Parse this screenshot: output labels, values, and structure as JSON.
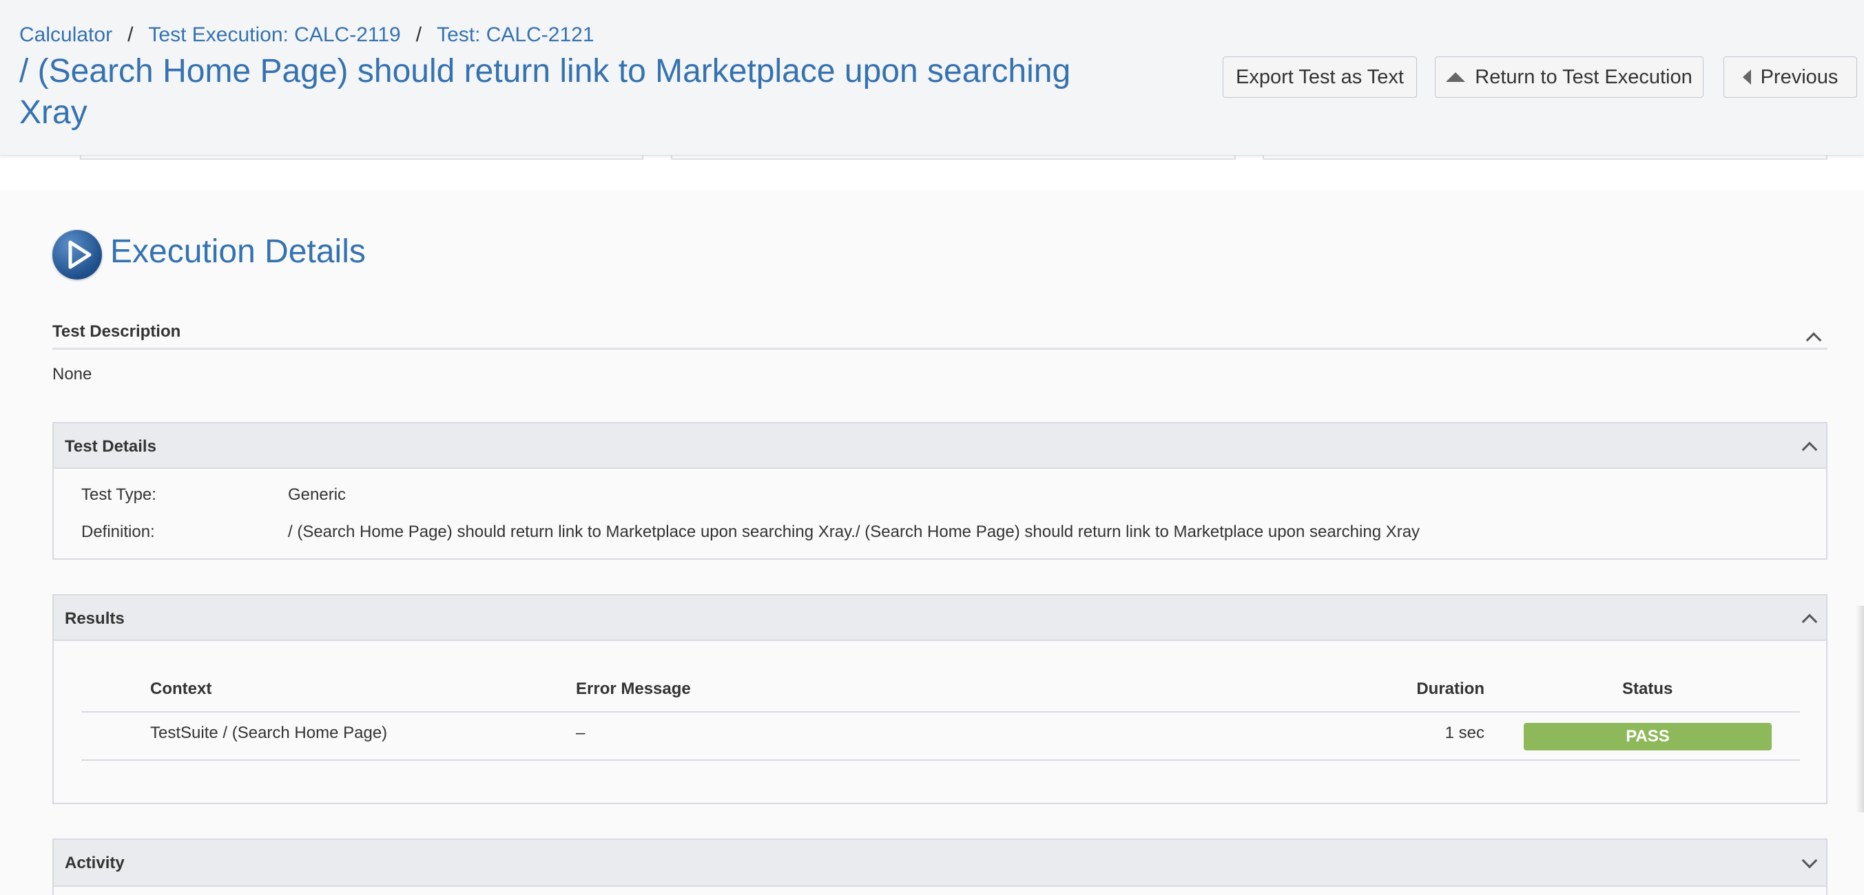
{
  "breadcrumb": {
    "items": [
      "Calculator",
      "Test Execution: CALC-2119",
      "Test: CALC-2121"
    ],
    "separator": "/"
  },
  "page_title": "/ (Search Home Page) should return link to Marketplace upon searching Xray",
  "header_buttons": {
    "export_label": "Export Test as Text",
    "return_label": "Return to Test Execution",
    "previous_label": "Previous"
  },
  "execution_details": {
    "title": "Execution Details",
    "icon": "play-icon"
  },
  "test_description": {
    "label": "Test Description",
    "value": "None"
  },
  "test_details": {
    "label": "Test Details",
    "test_type_label": "Test Type:",
    "test_type_value": "Generic",
    "definition_label": "Definition:",
    "definition_value": "/ (Search Home Page) should return link to Marketplace upon searching Xray./ (Search Home Page) should return link to Marketplace upon searching Xray"
  },
  "results": {
    "label": "Results",
    "columns": [
      "Context",
      "Error Message",
      "Duration",
      "Status"
    ],
    "rows": [
      {
        "context": "TestSuite / (Search Home Page)",
        "error": "–",
        "duration": "1 sec",
        "status": "PASS"
      }
    ]
  },
  "activity": {
    "label": "Activity"
  },
  "colors": {
    "link_blue": "#3572b0",
    "pass_green": "#8eb95b",
    "panel_header": "#e9ebee"
  }
}
